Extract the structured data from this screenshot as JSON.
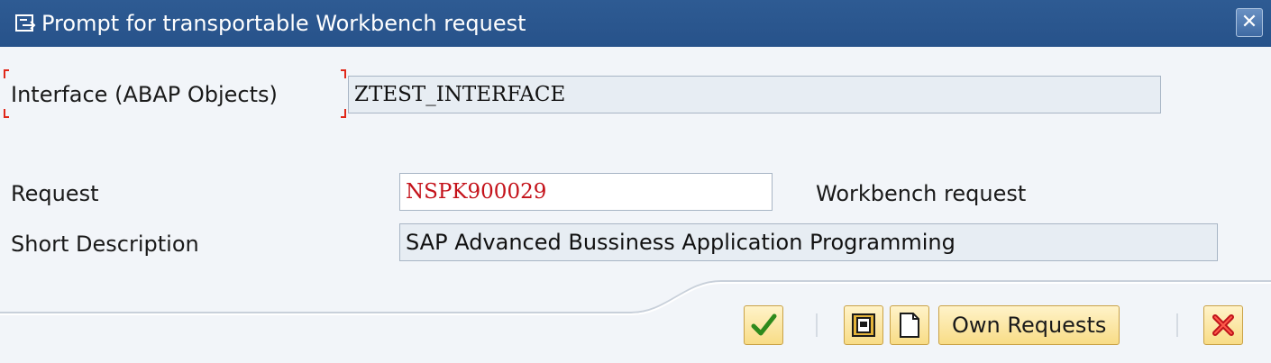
{
  "dialog": {
    "title": "Prompt for transportable Workbench request",
    "close_icon": "close-icon"
  },
  "object": {
    "label": "Interface (ABAP Objects)",
    "value": "ZTEST_INTERFACE"
  },
  "request": {
    "label": "Request",
    "value": "NSPK900029",
    "type_text": "Workbench request"
  },
  "short_description": {
    "label": "Short Description",
    "value": "SAP Advanced Bussiness Application Programming"
  },
  "toolbar": {
    "continue_icon": "checkmark-icon",
    "choose_icon": "choose-icon",
    "create_icon": "new-document-icon",
    "own_requests_label": "Own Requests",
    "cancel_icon": "cancel-x-icon"
  },
  "colors": {
    "titlebar": "#2e5b93",
    "request_text": "#c4121a",
    "button_bg": "#f8dc86"
  }
}
